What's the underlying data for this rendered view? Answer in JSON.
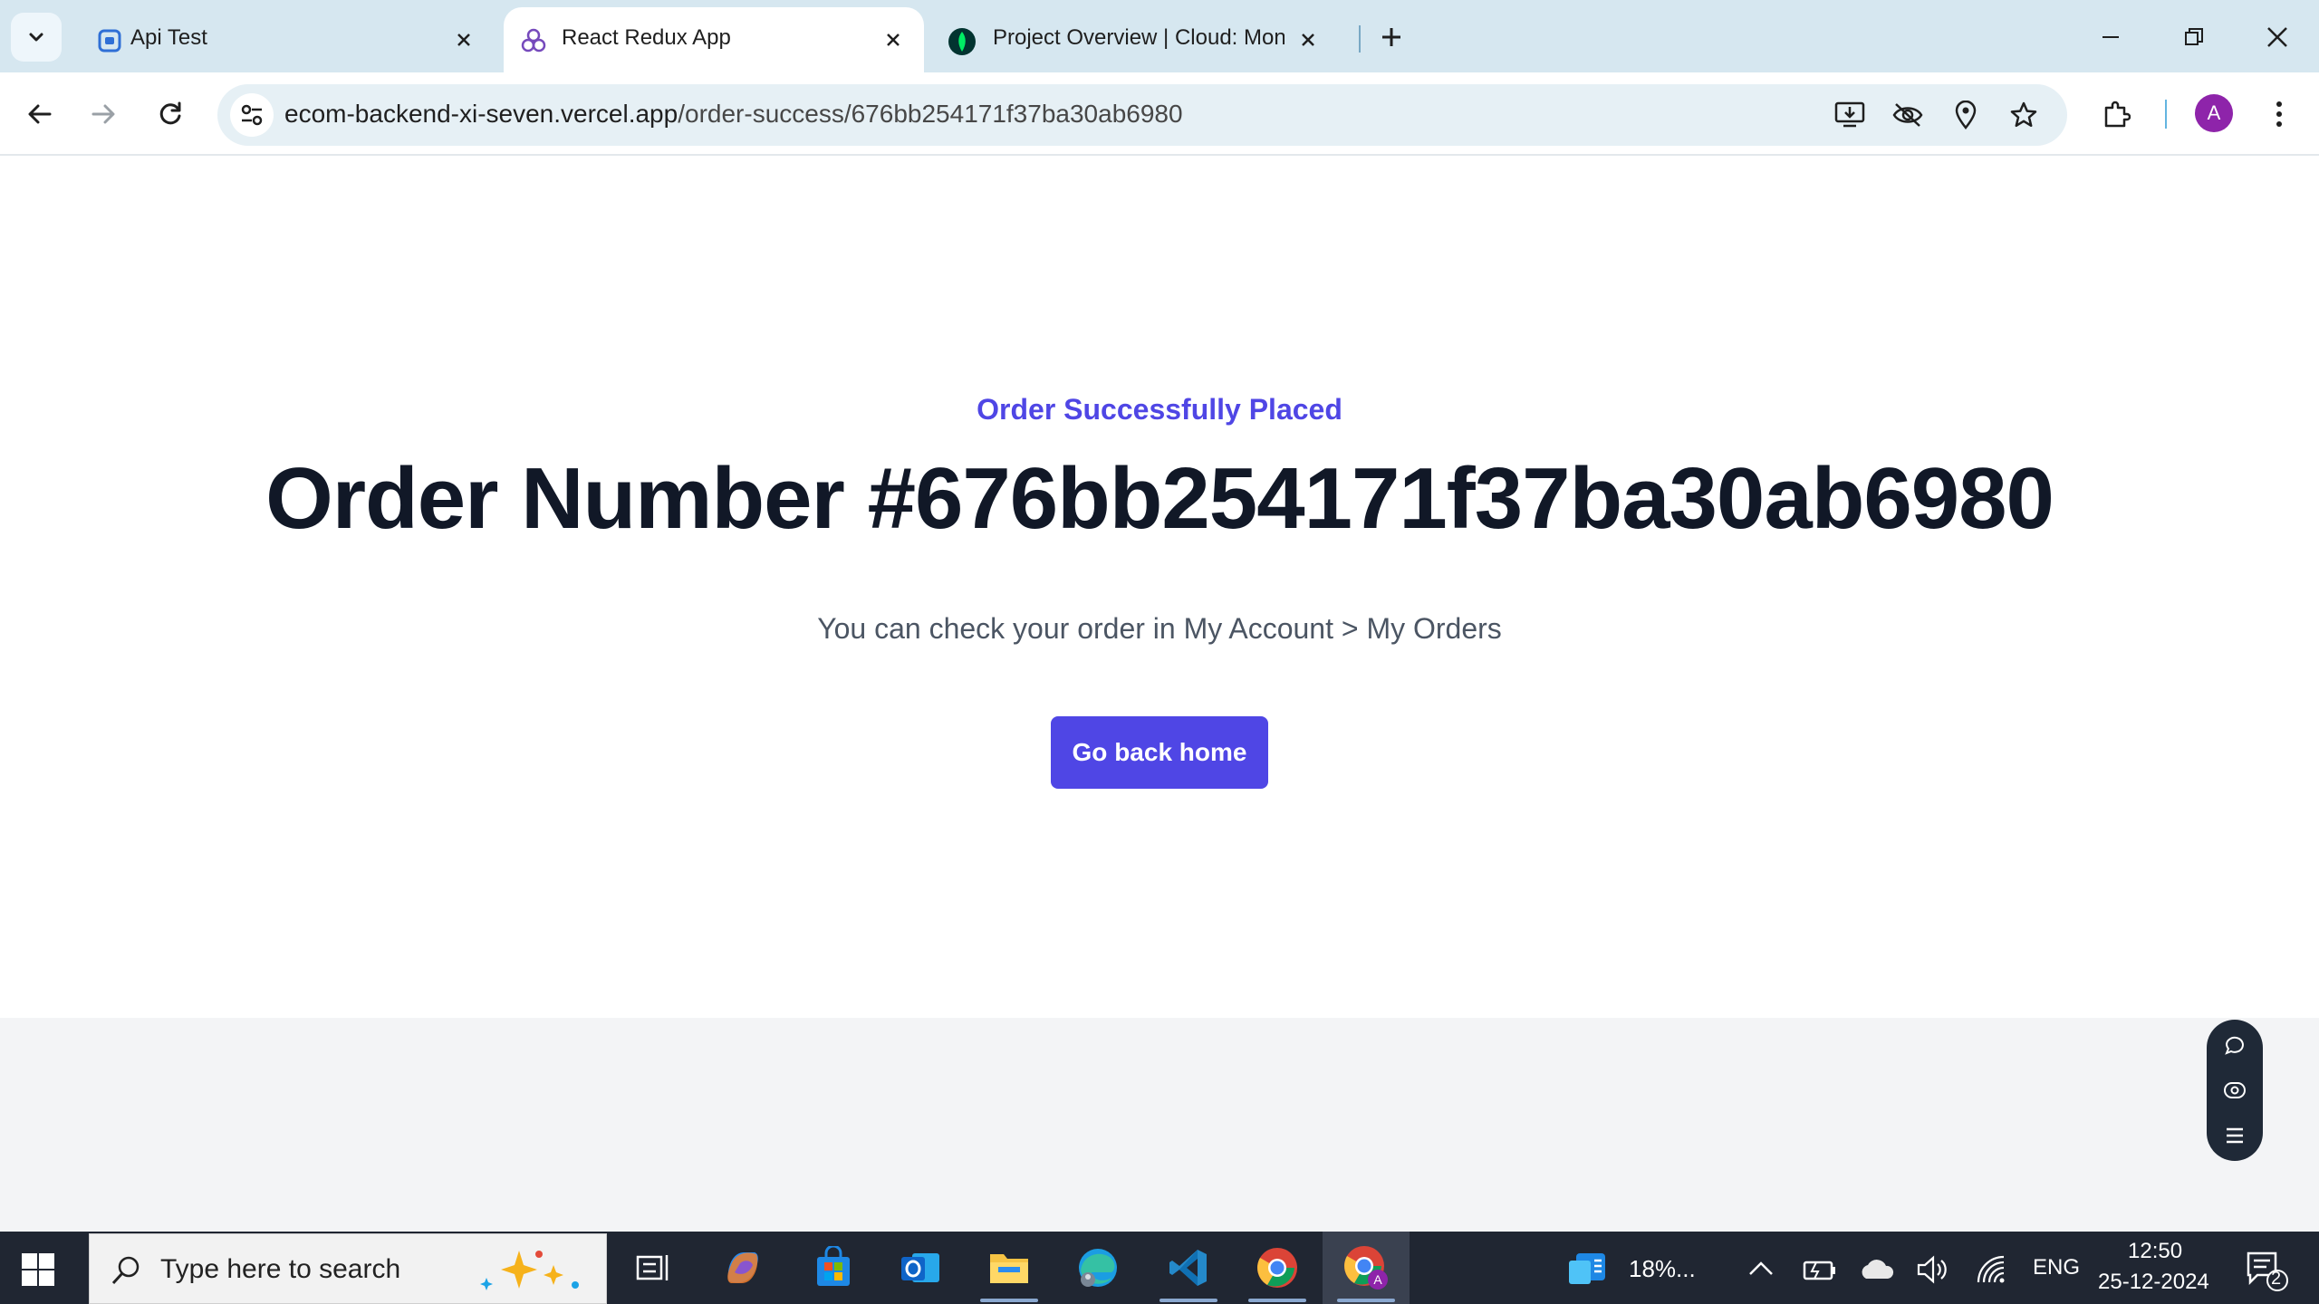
{
  "browser": {
    "tabs": [
      {
        "title": "Api Test",
        "active": false,
        "icon": "api-test-favicon"
      },
      {
        "title": "React Redux App",
        "active": true,
        "icon": "react-redux-favicon"
      },
      {
        "title": "Project Overview | Cloud: Mong",
        "active": false,
        "icon": "mongodb-leaf-favicon"
      }
    ],
    "url_host": "ecom-backend-xi-seven.vercel.app",
    "url_path": "/order-success/676bb254171f37ba30ab6980",
    "profile_initial": "A"
  },
  "page": {
    "eyebrow": "Order Successfully Placed",
    "heading": "Order Number #676bb254171f37ba30ab6980",
    "subtext": "You can check your order in My Account > My Orders",
    "button_label": "Go back home",
    "accent_color": "#4f46e5"
  },
  "taskbar": {
    "search_placeholder": "Type here to search",
    "weather_text": "18%...",
    "language": "ENG",
    "time": "12:50",
    "date": "25-12-2024",
    "notification_count": "2"
  }
}
